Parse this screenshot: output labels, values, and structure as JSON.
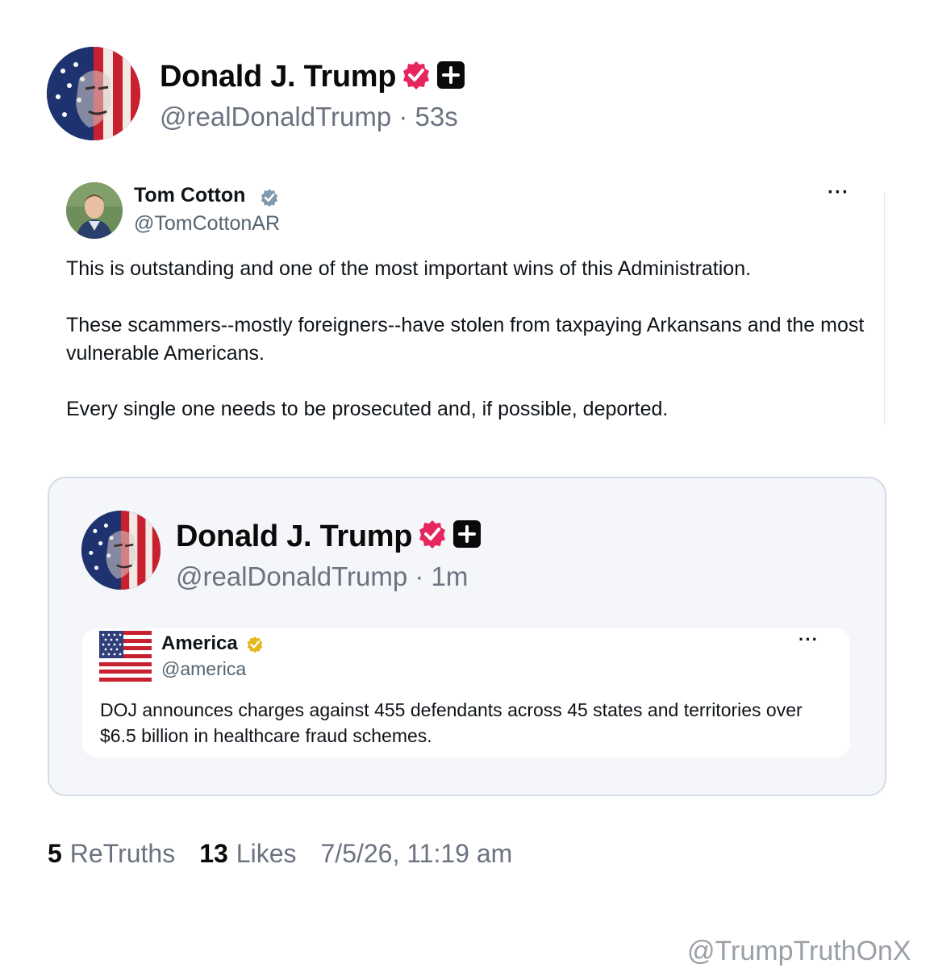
{
  "post": {
    "author_name": "Donald J. Trump",
    "handle_time": "@realDonaldTrump · 53s",
    "verified_badge_color": "#e8265e",
    "avatar_icon": "flag-face-avatar"
  },
  "quoted_tweet": {
    "author_name": "Tom Cotton",
    "handle": "@TomCottonAR",
    "more_label": "···",
    "paragraphs": [
      "This is outstanding and one of the most important wins of this Administration.",
      "These scammers--mostly foreigners--have stolen from taxpaying Arkansans and the most vulnerable Americans.",
      "Every single one needs to be prosecuted and, if possible, deported."
    ]
  },
  "embedded_post": {
    "author_name": "Donald J. Trump",
    "handle_time": "@realDonaldTrump · 1m",
    "inner_tweet": {
      "author_name": "America",
      "handle": "@america",
      "more_label": "···",
      "badge_color": "#e2b719",
      "text": "DOJ announces charges against 455 defendants across 45 states and territories over $6.5 billion in healthcare fraud schemes."
    }
  },
  "stats": {
    "retruths_count": "5",
    "retruths_label": "ReTruths",
    "likes_count": "13",
    "likes_label": "Likes",
    "timestamp": "7/5/26, 11:19 am"
  },
  "watermark": "@TrumpTruthOnX"
}
